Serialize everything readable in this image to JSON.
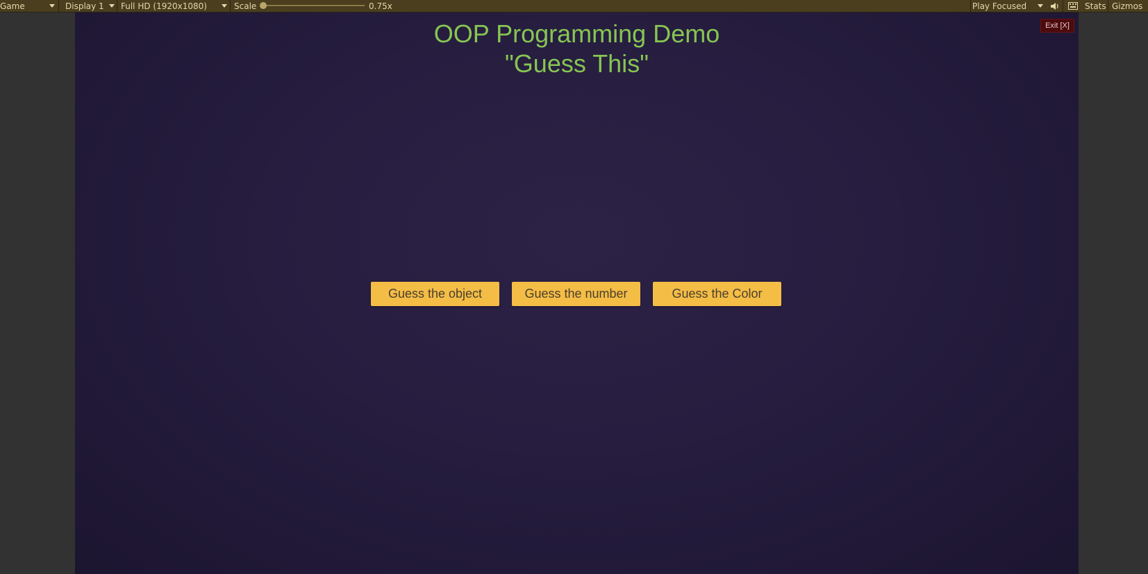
{
  "toolbar": {
    "view_tab": "Game",
    "display": "Display 1",
    "resolution": "Full HD (1920x1080)",
    "scale_label": "Scale",
    "scale_value": "0.75x",
    "play_mode": "Play Focused",
    "stats_label": "Stats",
    "gizmos_label": "Gizmos",
    "icons": [
      "dropdown-caret-icon",
      "speaker-icon",
      "keyboard-icon"
    ]
  },
  "game": {
    "title_line1": "OOP Programming Demo",
    "title_line2": "\"Guess This\"",
    "exit_label": "Exit [X]",
    "buttons": [
      {
        "label": "Guess the object"
      },
      {
        "label": "Guess the number"
      },
      {
        "label": "Guess the Color"
      }
    ]
  },
  "colors": {
    "title": "#87c552",
    "button_bg": "#f4bd45",
    "exit_bg": "#4b0a0c",
    "background": "#261d3f",
    "toolbar": "#4a3e1f"
  }
}
